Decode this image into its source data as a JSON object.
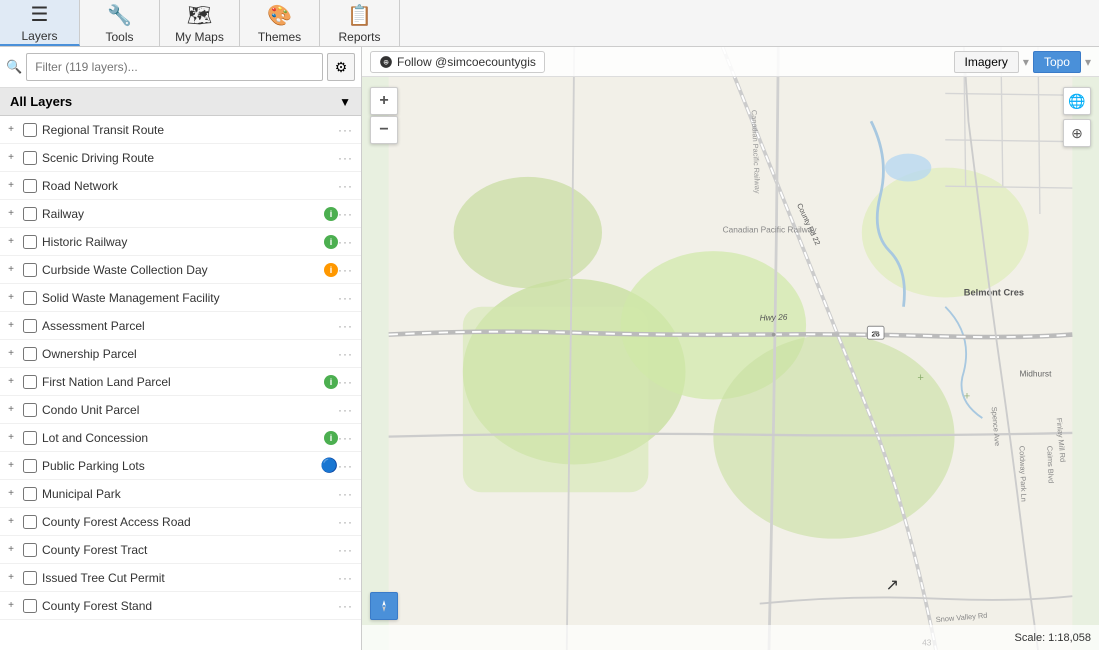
{
  "toolbar": {
    "buttons": [
      {
        "id": "layers",
        "label": "Layers",
        "icon": "☰",
        "active": true
      },
      {
        "id": "tools",
        "label": "Tools",
        "icon": "🔧",
        "active": false
      },
      {
        "id": "my-maps",
        "label": "My Maps",
        "icon": "🗺",
        "active": false
      },
      {
        "id": "themes",
        "label": "Themes",
        "icon": "🎨",
        "active": false
      },
      {
        "id": "reports",
        "label": "Reports",
        "icon": "📋",
        "active": false
      }
    ]
  },
  "filter": {
    "placeholder": "Filter (119 layers)...",
    "settings_icon": "⚙"
  },
  "layers_header": {
    "label": "All Layers",
    "chevron": "▼"
  },
  "layers": [
    {
      "id": 1,
      "name": "Regional Transit Route",
      "checked": false,
      "badge": null,
      "info": false
    },
    {
      "id": 2,
      "name": "Scenic Driving Route",
      "checked": false,
      "badge": null,
      "info": false
    },
    {
      "id": 3,
      "name": "Road Network",
      "checked": false,
      "badge": null,
      "info": false
    },
    {
      "id": 4,
      "name": "Railway",
      "checked": false,
      "badge": "green",
      "info": false
    },
    {
      "id": 5,
      "name": "Historic Railway",
      "checked": false,
      "badge": "green",
      "info": false
    },
    {
      "id": 6,
      "name": "Curbside Waste Collection Day",
      "checked": false,
      "badge": "orange",
      "info": false
    },
    {
      "id": 7,
      "name": "Solid Waste Management Facility",
      "checked": false,
      "badge": null,
      "info": false
    },
    {
      "id": 8,
      "name": "Assessment Parcel",
      "checked": false,
      "badge": null,
      "info": false
    },
    {
      "id": 9,
      "name": "Ownership Parcel",
      "checked": false,
      "badge": null,
      "info": false
    },
    {
      "id": 10,
      "name": "First Nation Land Parcel",
      "checked": false,
      "badge": "green",
      "info": false
    },
    {
      "id": 11,
      "name": "Condo Unit Parcel",
      "checked": false,
      "badge": null,
      "info": false
    },
    {
      "id": 12,
      "name": "Lot and Concession",
      "checked": false,
      "badge": "green",
      "info": false
    },
    {
      "id": 13,
      "name": "Public Parking Lots",
      "checked": false,
      "badge": null,
      "info": true
    },
    {
      "id": 14,
      "name": "Municipal Park",
      "checked": false,
      "badge": null,
      "info": false
    },
    {
      "id": 15,
      "name": "County Forest Access Road",
      "checked": false,
      "badge": null,
      "info": false
    },
    {
      "id": 16,
      "name": "County Forest Tract",
      "checked": false,
      "badge": null,
      "info": false
    },
    {
      "id": 17,
      "name": "Issued Tree Cut Permit",
      "checked": false,
      "badge": null,
      "info": false
    },
    {
      "id": 18,
      "name": "County Forest Stand",
      "checked": false,
      "badge": null,
      "info": false
    }
  ],
  "map": {
    "follow_label": "Follow @simcoecountygis",
    "mode_buttons": [
      {
        "id": "imagery",
        "label": "Imagery",
        "active": false
      },
      {
        "id": "topo",
        "label": "Topo",
        "active": true
      }
    ],
    "scale_label": "Scale: 1:18,058",
    "zoom_in": "+",
    "zoom_out": "−"
  }
}
